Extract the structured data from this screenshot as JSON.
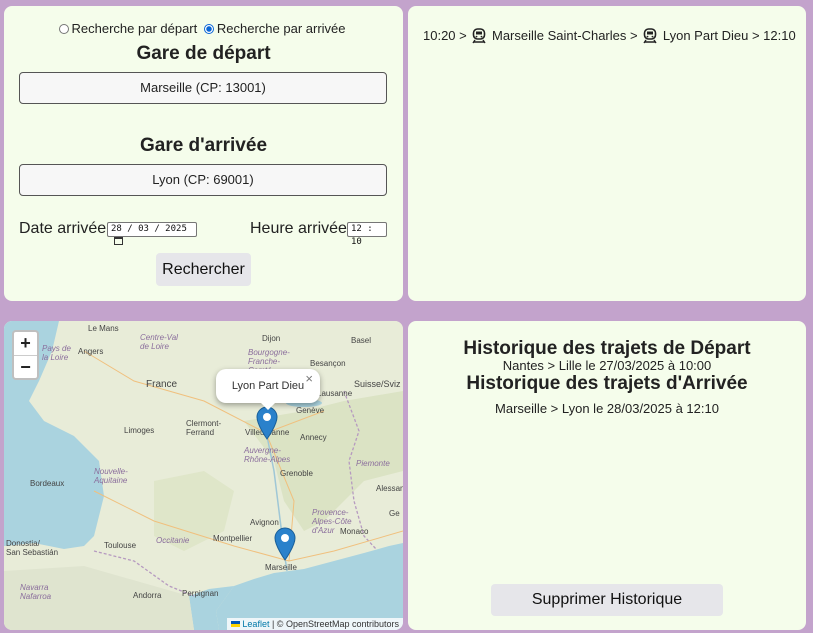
{
  "search": {
    "radio_depart": "Recherche par départ",
    "radio_arrivee": "Recherche par arrivée",
    "gare_depart_title": "Gare de départ",
    "gare_depart_value": "Marseille (CP: 13001)",
    "gare_arrivee_title": "Gare d'arrivée",
    "gare_arrivee_value": "Lyon (CP: 69001)",
    "date_label": "Date arrivée",
    "date_value": "28 / 03 / 2025",
    "heure_label": "Heure arrivée",
    "heure_value": "12 : 10",
    "button": "Rechercher"
  },
  "result": {
    "departure_time": "10:20 >",
    "from_station": "Marseille Saint-Charles >",
    "to_station": "Lyon Part Dieu > 12:10"
  },
  "map": {
    "zoom_in": "+",
    "zoom_out": "−",
    "popup_text": "Lyon Part Dieu",
    "popup_close": "×",
    "attribution_link": "Leaflet",
    "attribution_text": "| © OpenStreetMap contributors",
    "places": {
      "le_mans": "Le Mans",
      "angers": "Angers",
      "pays_loire": "Pays de\nla Loire",
      "centre_val": "Centre-Val\nde Loire",
      "france": "France",
      "dijon": "Dijon",
      "bourgogne": "Bourgogne-\nFranche-\nComté",
      "besancon": "Besançon",
      "basel": "Basel",
      "suisse": "Suisse/Sviz",
      "lausanne": "Lausanne",
      "geneve": "Genève",
      "limoges": "Limoges",
      "clermont": "Clermont-\nFerrand",
      "annecy": "Annecy",
      "auvergne": "Auvergne-\nRhône-Alpes",
      "grenoble": "Grenoble",
      "piemonte": "Piemonte",
      "bordeaux": "Bordeaux",
      "nouvelle": "Nouvelle-\nAquitaine",
      "alessan": "Alessan",
      "toulouse": "Toulouse",
      "occitanie": "Occitanie",
      "montpellier": "Montpellier",
      "avignon": "Avignon",
      "provence": "Provence-\nAlpes-Côte\nd'Azur",
      "monaco": "Monaco",
      "marseille": "Marseille",
      "donostia": "Donostia/\nSan Sebastián",
      "perpignan": "Perpignan",
      "andorra": "Andorra",
      "navarra": "Navarra\nNafarroa",
      "villeurbanne": "Villeurbanne",
      "ge": "Ge"
    },
    "colors": {
      "marker": "#2a81cb",
      "sea": "#aad3df",
      "land": "#e8ecd8"
    }
  },
  "history": {
    "title_depart": "Historique des trajets de Départ",
    "depart_item": "Nantes > Lille le 27/03/2025 à 10:00",
    "title_arrivee": "Historique des trajets d'Arrivée",
    "arrivee_item": "Marseille > Lyon le 28/03/2025 à 12:10",
    "button": "Supprimer Historique"
  }
}
